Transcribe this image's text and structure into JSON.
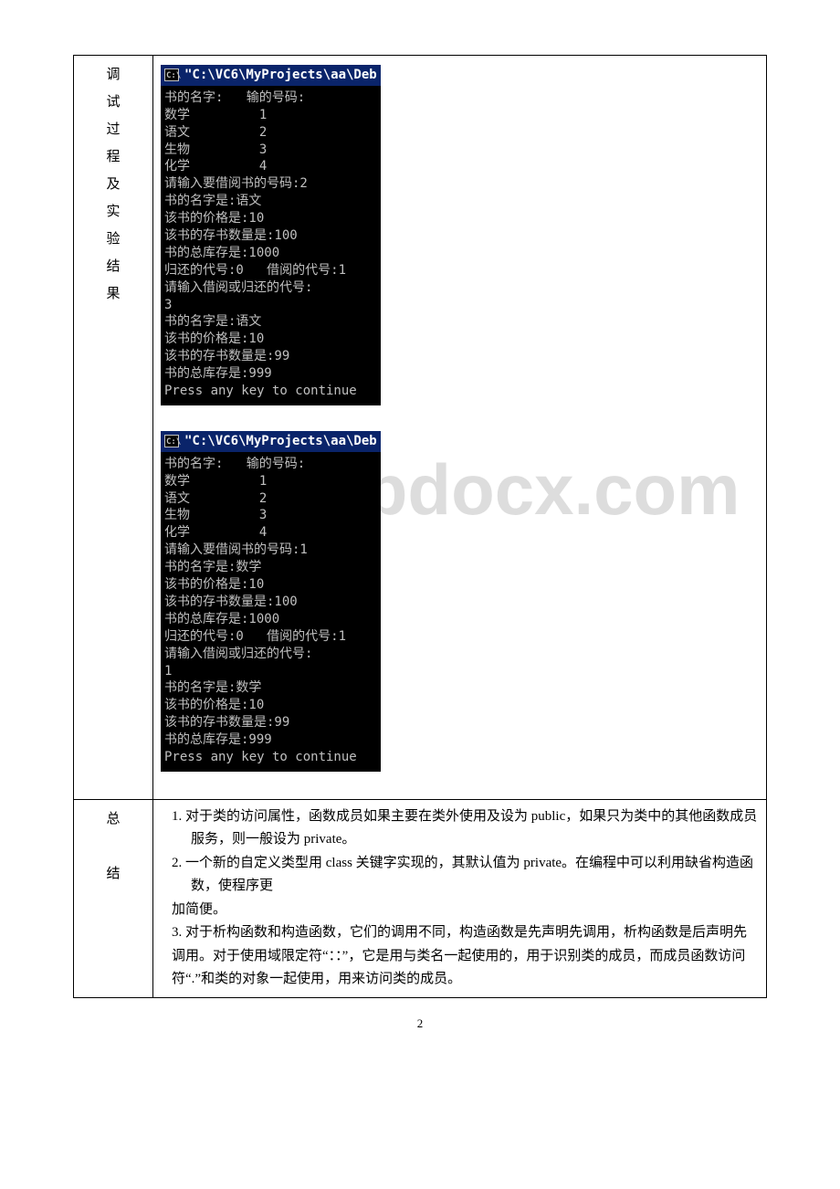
{
  "row1": {
    "label": "调试过程及实验结果",
    "console1": {
      "title_icon": "C:\\",
      "title_text": "\"C:\\VC6\\MyProjects\\aa\\Deb",
      "body": "书的名字:   输的号码:\n数学         1\n语文         2\n生物         3\n化学         4\n请输入要借阅书的号码:2\n书的名字是:语文\n该书的价格是:10\n该书的存书数量是:100\n书的总库存是:1000\n归还的代号:0   借阅的代号:1\n请输入借阅或归还的代号:\n3\n书的名字是:语文\n该书的价格是:10\n该书的存书数量是:99\n书的总库存是:999\nPress any key to continue"
    },
    "console2": {
      "title_icon": "C:\\",
      "title_text": "\"C:\\VC6\\MyProjects\\aa\\Deb",
      "body": "书的名字:   输的号码:\n数学         1\n语文         2\n生物         3\n化学         4\n请输入要借阅书的号码:1\n书的名字是:数学\n该书的价格是:10\n该书的存书数量是:100\n书的总库存是:1000\n归还的代号:0   借阅的代号:1\n请输入借阅或归还的代号:\n1\n书的名字是:数学\n该书的价格是:10\n该书的存书数量是:99\n书的总库存是:999\nPress any key to continue"
    },
    "watermark": "www.bdocx.com"
  },
  "row2": {
    "label": "总\n\n结",
    "p1": "1.  对于类的访问属性，函数成员如果主要在类外使用及设为 public，如果只为类中的其他函数成员服务，则一般设为 private。",
    "p2": "2.  一个新的自定义类型用 class 关键字实现的，其默认值为 private。在编程中可以利用缺省构造函数，使程序更",
    "p2b": "加简便。",
    "p3": "3.  对于析构函数和构造函数，它们的调用不同，构造函数是先声明先调用，析构函数是后声明先调用。对于使用域限定符“：：”，它是用与类名一起使用的，用于识别类的成员，而成员函数访问符“.”和类的对象一起使用，用来访问类的成员。"
  },
  "pageNumber": "2"
}
